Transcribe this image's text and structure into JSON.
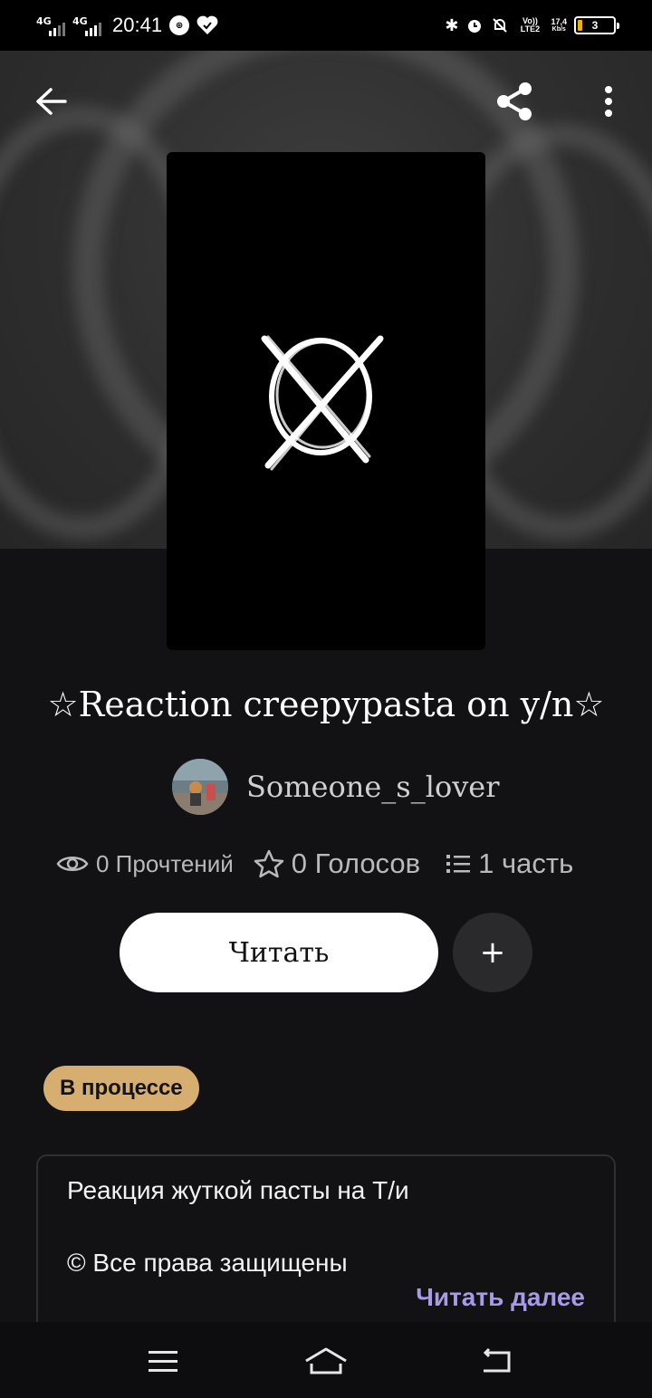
{
  "status_bar": {
    "signal_1": "4G",
    "signal_2": "4G",
    "time": "20:41",
    "badge_icon": "4G+",
    "net_type": "Vo)) LTE2",
    "speed_value": "17,4",
    "speed_unit": "Kb/s",
    "battery_level": "3"
  },
  "app_bar": {
    "back_icon": "arrow-left-icon",
    "share_icon": "share-icon",
    "more_icon": "more-vertical-icon"
  },
  "story": {
    "title": "☆Reaction creepypasta on y/n☆",
    "author": "Someone_s_lover",
    "stats": {
      "views": "0 Прочтений",
      "votes": "0 Голосов",
      "parts": "1 часть"
    },
    "read_label": "Читать",
    "add_label": "+",
    "status": "В процессе",
    "description_line_1": "Реакция жуткой пасты на Т/и",
    "description_line_2": "© Все права защищены",
    "read_more": "Читать далее"
  },
  "colors": {
    "status_badge": "#d6ae70",
    "read_more": "#a79be8",
    "background": "#121114"
  }
}
